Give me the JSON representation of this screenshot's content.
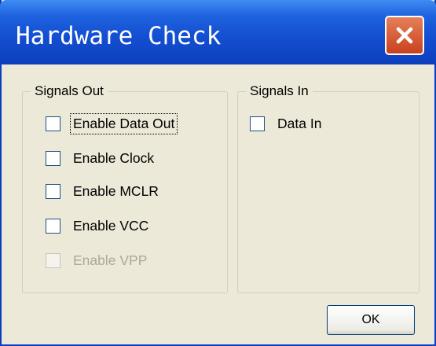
{
  "window": {
    "title": "Hardware Check",
    "close_icon": "close-icon",
    "title_bar_color": "#1450d2",
    "close_button_color": "#d9542c"
  },
  "signals_out": {
    "legend": "Signals Out",
    "items": [
      {
        "label": "Enable Data Out",
        "checked": false,
        "enabled": true,
        "focused": true
      },
      {
        "label": "Enable Clock",
        "checked": false,
        "enabled": true
      },
      {
        "label": "Enable MCLR",
        "checked": false,
        "enabled": true
      },
      {
        "label": "Enable VCC",
        "checked": false,
        "enabled": true
      },
      {
        "label": "Enable VPP",
        "checked": false,
        "enabled": false
      }
    ]
  },
  "signals_in": {
    "legend": "Signals In",
    "items": [
      {
        "label": "Data In",
        "checked": false,
        "enabled": true
      }
    ]
  },
  "buttons": {
    "ok_label": "OK"
  }
}
